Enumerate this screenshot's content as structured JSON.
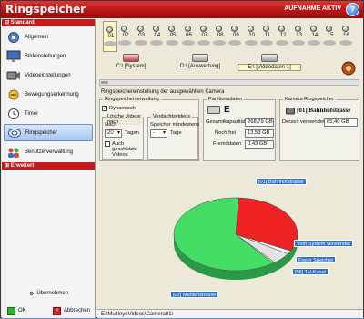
{
  "titlebar": {
    "title": "Ringspeicher",
    "status": "AUFNAHME AKTIV",
    "help_glyph": "?"
  },
  "sidebar": {
    "section_standard": "Standard",
    "section_erweitert": "Erweitert",
    "items": [
      {
        "label": "Allgemein"
      },
      {
        "label": "Bildeinstellungen"
      },
      {
        "label": "Videoeinstellungen"
      },
      {
        "label": "Bewegungserkennung"
      },
      {
        "label": "Timer"
      },
      {
        "label": "Ringspeicher"
      },
      {
        "label": "Benutzerverwaltung"
      }
    ],
    "apply_label": "Übernehmen",
    "ok_label": "OK",
    "cancel_label": "Abbrechen"
  },
  "cameras": [
    "01",
    "02",
    "03",
    "04",
    "05",
    "06",
    "07",
    "08",
    "09",
    "10",
    "11",
    "12",
    "13",
    "14",
    "15",
    "16"
  ],
  "drives": [
    {
      "label": "C:\\ [System]"
    },
    {
      "label": "D:\\ [Auswertung]"
    },
    {
      "label": "E:\\ [Videodaten 1]"
    }
  ],
  "hint": "Ringspeichereinstellung der ausgewählten Kamera",
  "ringverwaltung": {
    "header": "Ringspeicherverwaltung",
    "dynamic": "Dynamisch"
  },
  "loeschen": {
    "header": "Lösche Videos nach",
    "after_label": "Nach",
    "days_value": "20",
    "days_unit": "Tagen",
    "protected": "Auch geschützte Videos"
  },
  "verdacht": {
    "header": "Verdachtsvideos",
    "min_label": "Speicher mindestens",
    "min_value": "-",
    "min_unit": "Tage"
  },
  "partition": {
    "header": "Partitionsdaten",
    "drive": "E",
    "total_label": "Gesamtkapazität",
    "total_value": "268,79 GB",
    "free_label": "Noch frei",
    "free_value": "13,53 GB",
    "foreign_label": "Fremddaten",
    "foreign_value": "0,43 GB"
  },
  "kamera": {
    "header": "Kamera Ringspeicher",
    "name": "[01] Bahnhofstrasse",
    "used_label": "Derzeit verwendet",
    "used_value": "85,40 GB"
  },
  "chart_data": {
    "type": "pie",
    "labels": [
      "[01] Bahnhofstrasse",
      "Vom System verwendet",
      "Freier Speicher",
      "[05] TV-Kanal",
      "[02] Mühlenstrasse"
    ],
    "values": [
      85.4,
      4.0,
      13.53,
      1.5,
      164.36
    ],
    "colors": [
      "#ee2222",
      "#ffffff",
      "#e3e3e3",
      "#b7f2b7",
      "#44dd66"
    ]
  },
  "pathbar": "E:\\MultieyeVideos\\Camera01\\"
}
